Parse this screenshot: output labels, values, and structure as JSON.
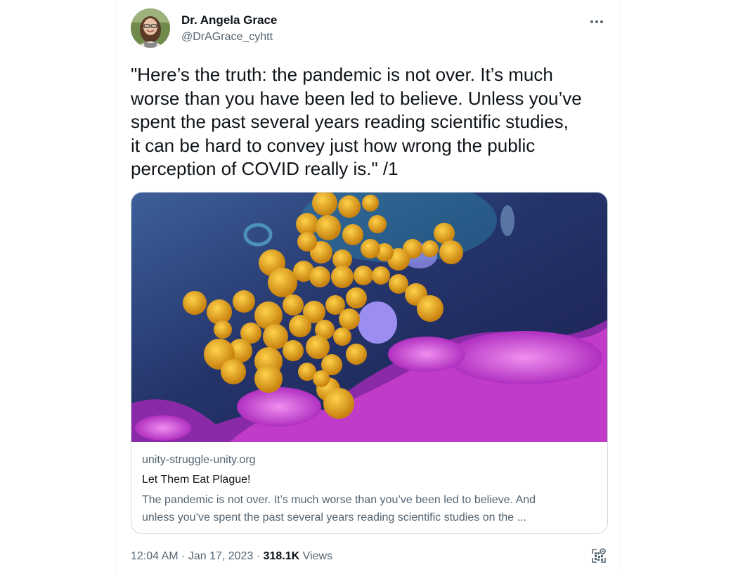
{
  "author": {
    "display_name": "Dr. Angela Grace",
    "handle": "@DrAGrace_cyhtt",
    "avatar_icon": "profile-photo"
  },
  "more_icon": "more-dots-icon",
  "tweet": {
    "text": "\"Here’s the truth: the pandemic is not over. It’s much\nworse than you have been led to believe. Unless you’ve\nspent the past several years reading scientific studies,\nit can be hard to convey just how wrong the public\nperception of COVID really is.\" /1"
  },
  "card": {
    "image_icon": "virus-micrograph-image",
    "domain": "unity-struggle-unity.org",
    "title": "Let Them Eat Plague!",
    "description_line1": "The pandemic is not over. It’s much worse than you’ve been led to believe. And",
    "description_line2": "unless you’ve spent the past several years reading scientific studies on the ..."
  },
  "meta": {
    "time": "12:04 AM",
    "separator": " · ",
    "date": "Jan 17, 2023",
    "views_count": "318.1K",
    "views_label": "Views"
  },
  "colors": {
    "text_primary": "#0f1419",
    "text_secondary": "#536471",
    "border": "#cfd9de",
    "virus": "#e8a21c",
    "cell_blue": "#3b4f86",
    "cell_magenta": "#d24fd8"
  },
  "qr_icon": "qr-code-view-icon"
}
